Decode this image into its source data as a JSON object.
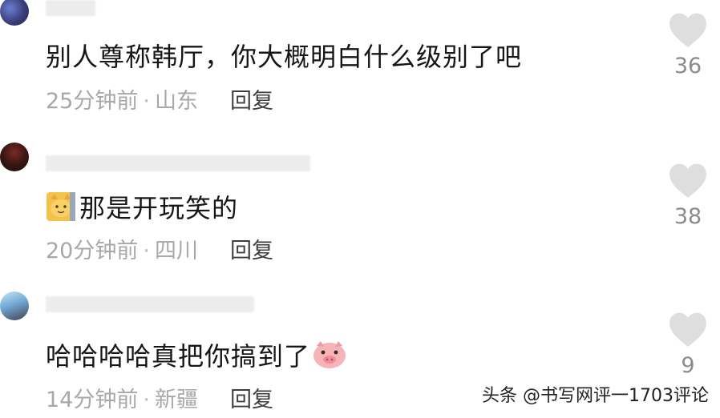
{
  "comments": [
    {
      "text": "别人尊称韩厅，你大概明白什么级别了吧",
      "time": "25分钟前",
      "location": "山东",
      "reply_label": "回复",
      "likes": "36"
    },
    {
      "text": "那是开玩笑的",
      "time": "20分钟前",
      "location": "四川",
      "reply_label": "回复",
      "likes": "38"
    },
    {
      "text": "哈哈哈哈真把你搞到了",
      "time": "14分钟前",
      "location": "新疆",
      "reply_label": "回复",
      "likes": "9"
    }
  ],
  "separator": "·",
  "watermark": "头条 @书写网评一1703评论",
  "colors": {
    "text": "#161616",
    "meta": "#a8a8a8",
    "reply": "#3e3e3e",
    "like_icon": "#dedede",
    "like_count": "#8b8b8b"
  }
}
